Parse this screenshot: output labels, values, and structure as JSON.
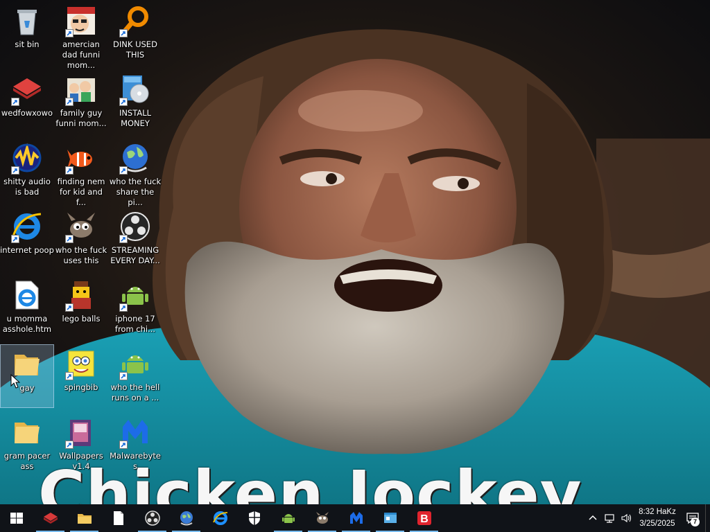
{
  "wallpaper": {
    "caption": "Chicken Jockey"
  },
  "desktop_icons": [
    {
      "name": "recycle-bin-icon",
      "label": "sit bin",
      "shortcut": false
    },
    {
      "name": "american-dad-icon",
      "label": "amercian dad funni mom...",
      "shortcut": true
    },
    {
      "name": "magnifier-icon",
      "label": "DINK USED THIS",
      "shortcut": true
    },
    {
      "name": "wedfowxowo-icon",
      "label": "wedfowxowo",
      "shortcut": true
    },
    {
      "name": "family-guy-icon",
      "label": "family guy funni mom...",
      "shortcut": true
    },
    {
      "name": "install-cd-icon",
      "label": "INSTALL MONEY",
      "shortcut": true
    },
    {
      "name": "audio-icon",
      "label": "shitty audio is bad",
      "shortcut": true
    },
    {
      "name": "nemo-fish-icon",
      "label": "finding nem for kid and f...",
      "shortcut": true
    },
    {
      "name": "globe-icon",
      "label": "who the fuck share the pi...",
      "shortcut": true
    },
    {
      "name": "internet-explorer-icon",
      "label": "internet poop",
      "shortcut": true
    },
    {
      "name": "gimp-icon",
      "label": "who the fuck uses this",
      "shortcut": true
    },
    {
      "name": "obs-icon",
      "label": "STREAMING EVERY DAY...",
      "shortcut": true
    },
    {
      "name": "html-file-icon",
      "label": "u momma asshole.htm",
      "shortcut": false
    },
    {
      "name": "lego-figure-icon",
      "label": "lego balls",
      "shortcut": true
    },
    {
      "name": "android-icon",
      "label": "iphone 17 from chi...",
      "shortcut": true
    },
    {
      "name": "folder-icon",
      "label": "gay",
      "shortcut": false,
      "selected": true
    },
    {
      "name": "spongebob-icon",
      "label": "spingbib",
      "shortcut": true
    },
    {
      "name": "android-icon",
      "label": "who the hell runs on a ...",
      "shortcut": true
    },
    {
      "name": "folder-icon",
      "label": "gram pacer ass",
      "shortcut": false
    },
    {
      "name": "wallpapers-book-icon",
      "label": "Wallpapers v1.4",
      "shortcut": true
    },
    {
      "name": "malwarebytes-icon",
      "label": "Malwarebytes",
      "shortcut": true
    }
  ],
  "taskbar": {
    "clock": {
      "time": "8:32 HaKz",
      "date": "3/25/2025"
    },
    "notification_count": "7"
  },
  "colors": {
    "taskbar_bg": "#101318",
    "accent": "#76b9ed",
    "sweater": "#1592a6"
  }
}
